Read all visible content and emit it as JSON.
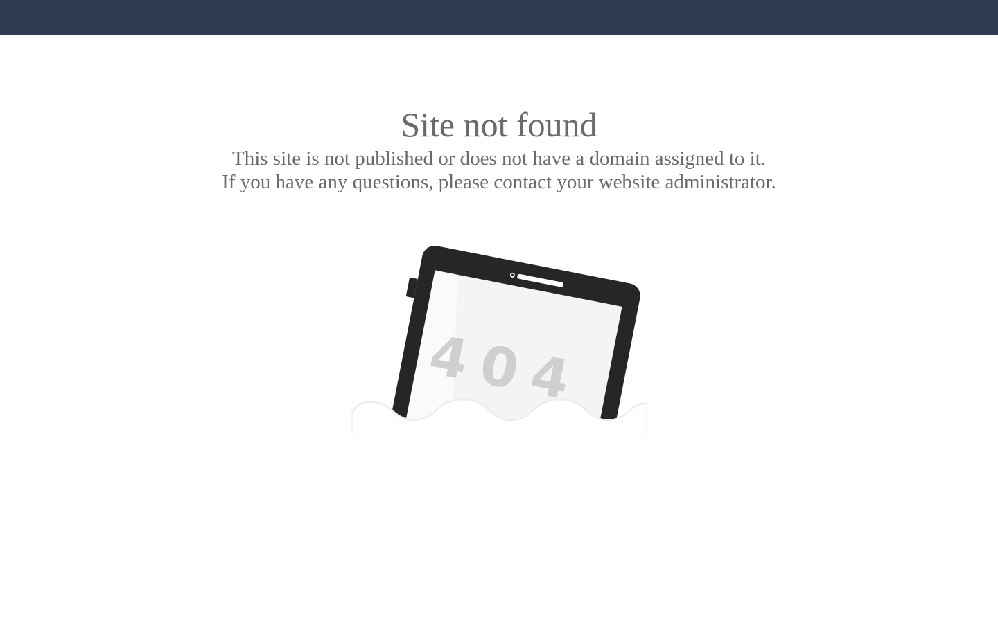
{
  "header": {
    "bar_color": "#2e3e50"
  },
  "main": {
    "title": "Site not found",
    "message_line_1": "This site is not published or does not have a domain assigned to it.",
    "message_line_2": "If you have any questions, please contact your website administrator."
  },
  "illustration": {
    "icon": "tablet-404-icon",
    "code": "404"
  },
  "colors": {
    "text": "#6b6b6b",
    "device": "#262626",
    "screen": "#f4f4f4",
    "code_text": "#cfcfcf"
  }
}
